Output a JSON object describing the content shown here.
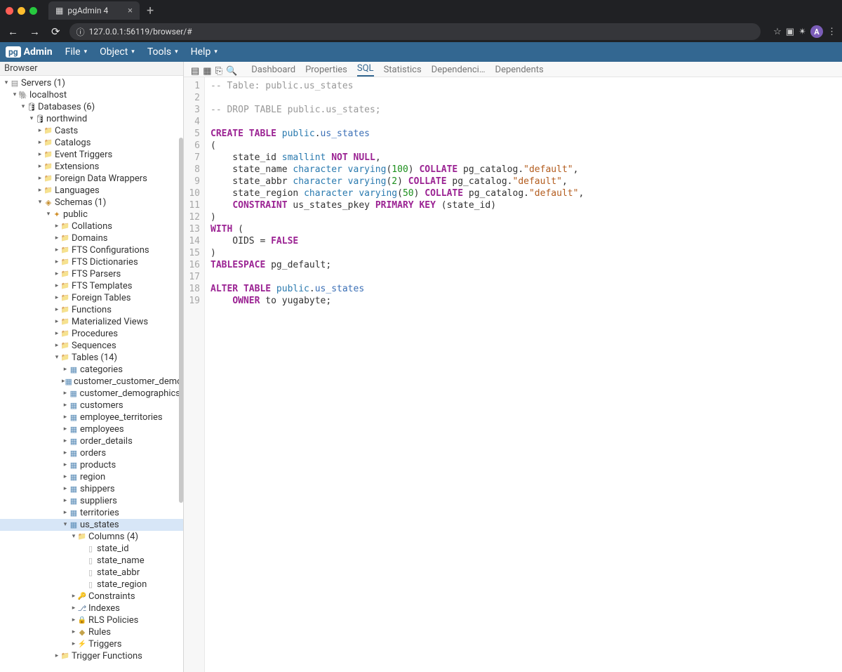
{
  "browser": {
    "tab_title": "pgAdmin 4",
    "url": "127.0.0.1:56119/browser/#",
    "avatar_letter": "A"
  },
  "menubar": {
    "logo_prefix": "pg",
    "logo_text": "Admin",
    "items": [
      "File",
      "Object",
      "Tools",
      "Help"
    ]
  },
  "sidebar": {
    "header": "Browser",
    "tree": {
      "servers": "Servers (1)",
      "host": "localhost",
      "databases": "Databases (6)",
      "db": "northwind",
      "db_children": [
        "Casts",
        "Catalogs",
        "Event Triggers",
        "Extensions",
        "Foreign Data Wrappers",
        "Languages"
      ],
      "schemas": "Schemas (1)",
      "public": "public",
      "public_children_top": [
        "Collations",
        "Domains",
        "FTS Configurations",
        "FTS Dictionaries",
        "FTS Parsers",
        "FTS Templates",
        "Foreign Tables",
        "Functions",
        "Materialized Views",
        "Procedures",
        "Sequences"
      ],
      "tables_label": "Tables (14)",
      "tables": [
        "categories",
        "customer_customer_demo",
        "customer_demographics",
        "customers",
        "employee_territories",
        "employees",
        "order_details",
        "orders",
        "products",
        "region",
        "shippers",
        "suppliers",
        "territories",
        "us_states"
      ],
      "columns_label": "Columns (4)",
      "columns": [
        "state_id",
        "state_name",
        "state_abbr",
        "state_region"
      ],
      "table_children_after": [
        "Constraints",
        "Indexes",
        "RLS Policies",
        "Rules",
        "Triggers"
      ],
      "trigger_functions": "Trigger Functions"
    }
  },
  "tabs": {
    "items": [
      "Dashboard",
      "Properties",
      "SQL",
      "Statistics",
      "Dependenci…",
      "Dependents"
    ],
    "active_index": 2
  },
  "sql": {
    "line1_comment": "-- Table: public.us_states",
    "line3_comment": "-- DROP TABLE public.us_states;",
    "create": "CREATE TABLE",
    "public": "public",
    "dot": ".",
    "tablename": "us_states",
    "lp": "(",
    "rp": ")",
    "col_state_id": "state_id",
    "smallint": "smallint",
    "not": "NOT",
    "null": "NULL",
    "comma": ",",
    "col_state_name": "state_name",
    "charvarying": "character varying",
    "n100": "100",
    "n2": "2",
    "n50": "50",
    "collate": "COLLATE",
    "pgcatalog": "pg_catalog",
    "default_q": "\"default\"",
    "col_state_abbr": "state_abbr",
    "col_state_region": "state_region",
    "constraint": "CONSTRAINT",
    "pkey": "us_states_pkey",
    "primarykey": "PRIMARY KEY",
    "with": "WITH",
    "oids": "OIDS",
    "eq": "=",
    "false": "FALSE",
    "tablespace": "TABLESPACE",
    "pg_default": "pg_default;",
    "alter": "ALTER TABLE",
    "owner": "OWNER",
    "to": "to",
    "yugabyte": "yugabyte;"
  }
}
